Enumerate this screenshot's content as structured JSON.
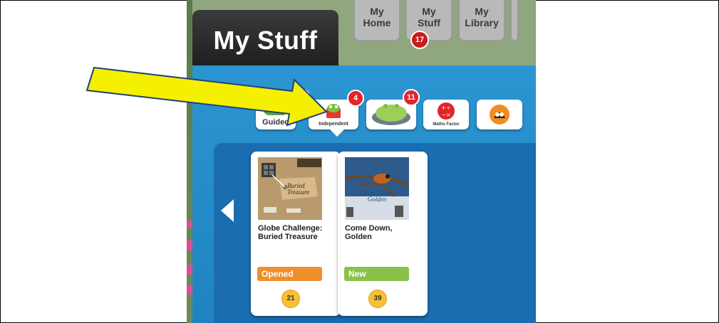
{
  "header": {
    "title": "My Stuff",
    "nav_tabs": [
      {
        "line1": "My",
        "line2": "Home"
      },
      {
        "line1": "My",
        "line2": "Stuff"
      },
      {
        "line1": "My",
        "line2": "Library"
      }
    ],
    "stuff_badge": "17"
  },
  "categories": [
    {
      "label": "Guided",
      "badge": ""
    },
    {
      "label": "Independent",
      "badge": "4"
    },
    {
      "label": "",
      "badge": "11"
    },
    {
      "label": "Maths Factor",
      "badge": ""
    },
    {
      "label": "",
      "badge": ""
    }
  ],
  "books": [
    {
      "title": "Globe Challenge: Buried Treasure",
      "status": "Opened",
      "status_color": "#ef8f2c",
      "level": "21",
      "cover_text": "Buried Treasure"
    },
    {
      "title": "Come Down, Golden",
      "status": "New",
      "status_color": "#8ac14a",
      "level": "39",
      "cover_text": "Come Down, Golden"
    }
  ],
  "colors": {
    "panel_blue": "#2b95d1",
    "shelf_blue": "#1a6db0",
    "badge_red": "#e1262a",
    "annotation_arrow": "#f4f000"
  }
}
